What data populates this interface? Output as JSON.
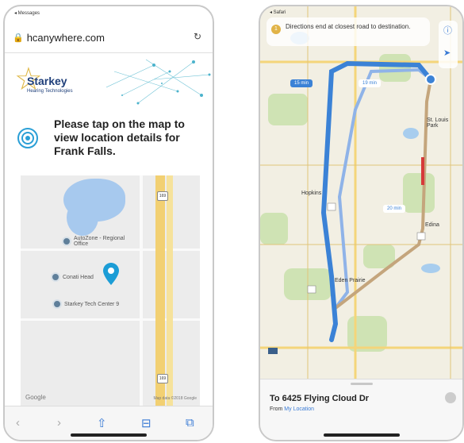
{
  "left": {
    "status": "◂ Messages",
    "url": "hcanywhere.com",
    "brand_name": "Starkey",
    "brand_sub": "Hearing Technologies",
    "prompt": "Please tap on the map to view location details for Frank Falls.",
    "map": {
      "pois": [
        "AutoZone - Regional Office",
        "Conati Headquarters",
        "Starkey Tech Center 9"
      ],
      "pin_label": "Conati Head",
      "google": "Google",
      "map_data": "Map data ©2018 Google",
      "shield_top": "169",
      "shield_mid": "169"
    }
  },
  "right": {
    "status": "◂ Safari",
    "banner_num": "1",
    "banner_text": "Directions end at closest road to destination.",
    "times": [
      "15 min",
      "19 min",
      "20 min"
    ],
    "places": [
      "St. Louis Park",
      "Hopkins",
      "Edina",
      "Eden Prairie"
    ],
    "card_title": "To 6425 Flying Cloud Dr",
    "card_from_prefix": "From",
    "card_from_link": "My Location"
  },
  "colors": {
    "route_primary": "#3b82d6",
    "route_alt": "#8fb3e8",
    "pin": "#1c9dd6",
    "logo": "#1f3f7a",
    "star": "#e0b94a"
  }
}
